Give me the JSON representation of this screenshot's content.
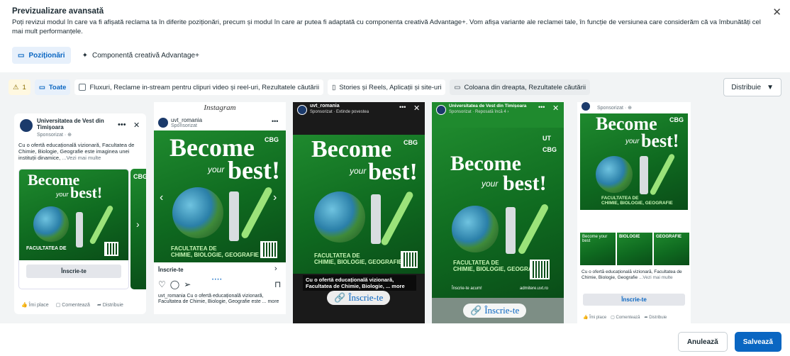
{
  "header": {
    "title": "Previzualizare avansată",
    "description": "Poți revizui modul în care va fi afișată reclama ta în diferite poziționări, precum și modul în care ar putea fi adaptată cu componenta creativă Advantage+. Vom afișa variante ale reclamei tale, în funcție de versiunea care considerăm că va îmbunătăți cel mai mult performanțele.",
    "close_icon": "close-icon"
  },
  "tabs": [
    {
      "label": "Poziționări",
      "active": true,
      "icon": "placements-icon"
    },
    {
      "label": "Componentă creativă Advantage+",
      "active": false,
      "icon": "sparkle-icon"
    }
  ],
  "filters": {
    "warning_count": "1",
    "all_label": "Toate",
    "feeds_label": "Fluxuri, Reclame in-stream pentru clipuri video și reel-uri, Rezultatele căutării",
    "stories_label": "Stories și Reels, Aplicații și site-uri",
    "column_label": "Coloana din dreapta, Rezultatele căutării",
    "distribute_label": "Distribuie"
  },
  "previews": {
    "facebook_feed": {
      "page_name": "Universitatea de Vest din Timișoara",
      "sponsored": "Sponsorizat · ⊕",
      "text": "Cu o ofertă educațională vizionară, Facultatea de Chimie, Biologie, Geografie este imaginea unei instituții dinamice,",
      "see_more": "...Vezi mai multe",
      "cta": "Înscrie-te",
      "like": "Îmi place",
      "comment": "Comentează",
      "share": "Distribuie"
    },
    "instagram_feed": {
      "brand": "Instagram",
      "account": "uvt_romania",
      "sponsored": "Sponsorizat",
      "cta": "Înscrie-te",
      "caption": "uvt_romania Cu o ofertă educațională vizionară, Facultatea de Chimie, Biologie, Geografie este ... more"
    },
    "ig_story": {
      "account": "uvt_romania",
      "sponsored": "Sponsorizat · Extinde povestea",
      "caption": "Cu o ofertă educațională vizionară, Facultatea de Chimie, Biologie, ... more",
      "cta": "Înscrie-te"
    },
    "fb_story": {
      "page_name": "Universitatea de Vest din Timișoara",
      "sponsored": "Sponsorizat · Reposată încă 4 ›",
      "enroll": "Înscrie-te acum!",
      "site": "admitere.uvt.ro",
      "cta": "Înscrie-te"
    },
    "right_column": {
      "sponsored": "Sponsorizat · ⊕",
      "caption": "Cu o ofertă educațională vizionară, Facultatea de Chimie, Biologie, Geografie",
      "see_more": "...Vezi mai multe",
      "cta": "Înscrie-te",
      "like": "Îmi place",
      "comment": "Comentează",
      "share": "Distribuie",
      "carousel": [
        {
          "title": "Become your best"
        },
        {
          "title": "BIOLOGIE"
        },
        {
          "title": "GEOGRAFIE"
        }
      ]
    },
    "creative": {
      "line1": "Become",
      "line2": "your",
      "line3": "best!",
      "badge": "CBG",
      "faculty": "FACULTATEA DE",
      "subjects": "CHIMIE, BIOLOGIE, GEOGRAFIE"
    }
  },
  "footer": {
    "cancel": "Anulează",
    "save": "Salvează"
  }
}
